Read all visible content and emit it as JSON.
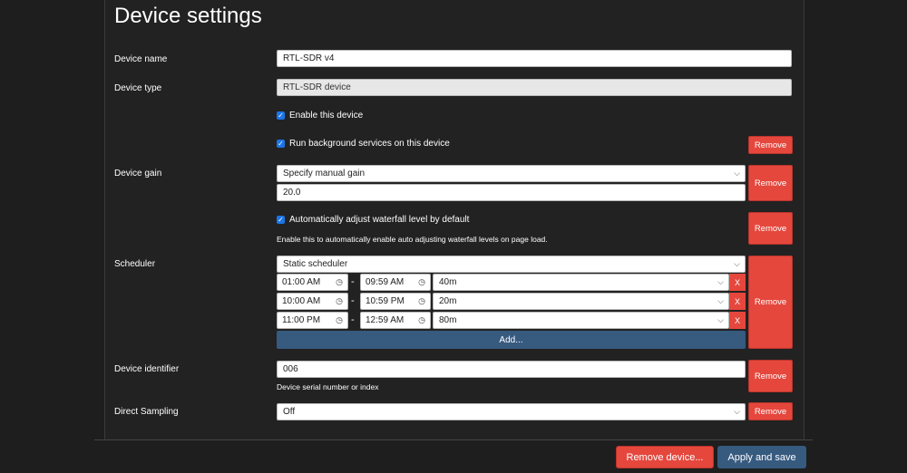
{
  "page": {
    "title": "Device settings"
  },
  "fields": {
    "device_name": {
      "label": "Device name",
      "value": "RTL-SDR v4"
    },
    "device_type": {
      "label": "Device type",
      "value": "RTL-SDR device"
    },
    "enable_device": {
      "label": "Enable this device",
      "checked": true
    },
    "background_services": {
      "label": "Run background services on this device",
      "checked": true
    },
    "device_gain": {
      "label": "Device gain",
      "mode": "Specify manual gain",
      "value": "20.0"
    },
    "auto_waterfall": {
      "label": "Automatically adjust waterfall level by default",
      "checked": true,
      "hint": "Enable this to automatically enable auto adjusting waterfall levels on page load."
    },
    "scheduler": {
      "label": "Scheduler",
      "type": "Static scheduler",
      "entries": [
        {
          "start": "01:00 AM",
          "end": "09:59 AM",
          "profile": "40m"
        },
        {
          "start": "10:00 AM",
          "end": "10:59 PM",
          "profile": "20m"
        },
        {
          "start": "11:00 PM",
          "end": "12:59 AM",
          "profile": "80m"
        }
      ],
      "add_label": "Add...",
      "range_sep": "-",
      "delete_label": "X"
    },
    "device_identifier": {
      "label": "Device identifier",
      "value": "006",
      "hint": "Device serial number or index"
    },
    "direct_sampling": {
      "label": "Direct Sampling",
      "value": "Off"
    }
  },
  "buttons": {
    "remove": "Remove",
    "remove_device": "Remove device...",
    "apply": "Apply and save"
  },
  "colors": {
    "danger": "#e5473d",
    "primary": "#375a7f",
    "checkbox": "#1b74e8"
  },
  "icons": {
    "clock": "clock-icon",
    "chevron": "chevron-down-icon",
    "check": "checkmark-icon"
  }
}
